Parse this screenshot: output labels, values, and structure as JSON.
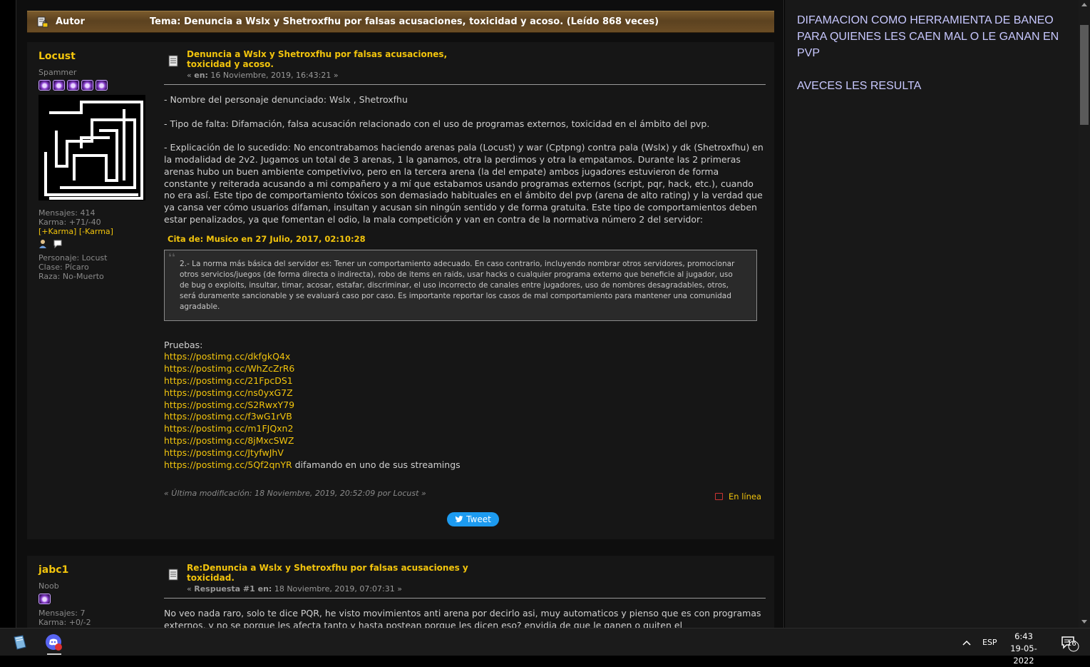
{
  "header": {
    "autor_label": "Autor",
    "topic_title": "Tema: Denuncia a Wslx y Shetroxfhu por falsas acusaciones, toxicidad y acoso.  (Leído 868 veces)"
  },
  "post1": {
    "username": "Locust",
    "rank": "Spammer",
    "stars": 5,
    "stats": {
      "messages": "Mensajes: 414",
      "karma": "Karma: +71/-40",
      "karma_plus": "[+Karma]",
      "karma_minus": "[-Karma]",
      "character": "Personaje: Locust",
      "class": "Clase: Pícaro",
      "race": "Raza: No-Muerto"
    },
    "title": "Denuncia a Wslx y Shetroxfhu por falsas acusaciones, toxicidad y acoso.",
    "date_prefix": "« ",
    "date_label": "en:",
    "date_value": " 16 Noviembre, 2019, 16:43:21 »",
    "paragraphs": [
      "- Nombre del personaje denunciado: Wslx , Shetroxfhu",
      "- Tipo de falta: Difamación, falsa acusación relacionado con el uso de programas externos, toxicidad en el ámbito del pvp.",
      "- Explicación de lo sucedido: No encontrabamos haciendo arenas pala (Locust) y war (Cptpng) contra pala (Wslx) y dk (Shetroxfhu) en la modalidad de 2v2. Jugamos un total de 3 arenas, 1 la ganamos, otra la perdimos y otra la empatamos. Durante las 2 primeras arenas hubo un buen ambiente competivivo, pero en la tercera arena (la del empate) ambos jugadores estuvieron de forma constante y reiterada acusando a mi compañero y a mí que estabamos usando programas externos (script, pqr, hack, etc.), cuando no era así. Este tipo de comportamiento tóxicos son demasiado habituales en el ámbito del pvp (arena de alto rating) y la verdad que ya cansa ver cómo usuarios difaman, insultan y acusan sin ningún sentido y de forma gratuita. Este tipo de comportamientos deben estar penalizados, ya que fomentan el odio, la mala competición y van en contra de la normativa número 2 del servidor:"
    ],
    "quote_header": "Cita de: Musico en 27 Julio, 2017, 02:10:28",
    "quote_text": "2.- La norma más básica del servidor es: Tener un comportamiento adecuado. En caso contrario, incluyendo nombrar otros servidores, promocionar otros servicios/juegos (de forma directa o indirecta), robo de items en raids, usar hacks o cualquier programa externo que beneficie al jugador, uso de bug o exploits, insultar, timar, acosar, estafar, discriminar, el uso incorrecto de canales entre jugadores, uso de nombres desagradables, otros, será duramente sancionable y se evaluará caso por caso. Es importante reportar los casos de mal comportamiento para mantener una comunidad agradable.",
    "proofs_label": "Pruebas:",
    "links": [
      "https://postimg.cc/dkfgkQ4x",
      "https://postimg.cc/WhZcZrR6",
      "https://postimg.cc/21FpcDS1",
      "https://postimg.cc/ns0yxG7Z",
      "https://postimg.cc/S2RwxY79",
      "https://postimg.cc/f3wG1rVB",
      "https://postimg.cc/m1FJQxn2",
      "https://postimg.cc/8jMxcSWZ",
      "https://postimg.cc/JtyfwJhV",
      "https://postimg.cc/5Qf2qnYR"
    ],
    "last_link_suffix": "difamando en uno de sus streamings",
    "last_modified": "« Última modificación: 18 Noviembre, 2019, 20:52:09 por Locust »",
    "online": "En línea",
    "tweet": "Tweet"
  },
  "post2": {
    "username": "jabc1",
    "rank": "Noob",
    "stars": 1,
    "stats": {
      "messages": "Mensajes: 7",
      "karma": "Karma: +0/-2"
    },
    "title": "Re:Denuncia a Wslx y Shetroxfhu por falsas acusaciones y toxicidad.",
    "date_prefix": "« ",
    "date_label": "Respuesta #1 en:",
    "date_value": " 18 Noviembre, 2019, 07:07:31 »",
    "text": "No veo nada raro, solo te dice PQR, he visto movimientos anti arena por decirlo asi, muy automaticos y pienso que es con programas externos, y no se porque les afecta tanto y hasta postean porque les dicen eso? envidia de que le ganen o quiten el"
  },
  "sidebar": {
    "line1": "DIFAMACION COMO HERRAMIENTA DE BANEO PARA QUIENES LES CAEN MAL O LE GANAN EN PVP",
    "line2": "AVECES LES RESULTA"
  },
  "taskbar": {
    "language": "ESP",
    "time": "6:43",
    "date": "19-05-2022",
    "notification_count": "16"
  },
  "colors": {
    "accent": "#f2c40c",
    "header_bar": "#5c4220",
    "sidebar_text": "#c8c8ff"
  }
}
